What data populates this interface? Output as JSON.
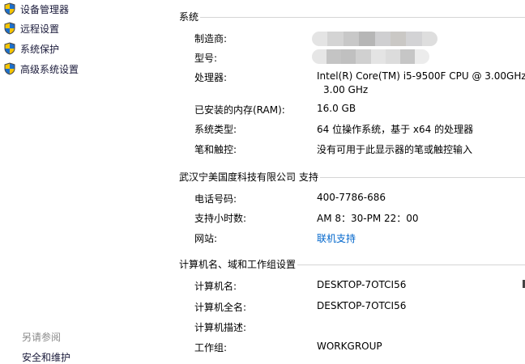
{
  "sidebar": {
    "items": [
      {
        "label": "设备管理器",
        "icon": "uac-shield-icon"
      },
      {
        "label": "远程设置",
        "icon": "uac-shield-icon"
      },
      {
        "label": "系统保护",
        "icon": "uac-shield-icon"
      },
      {
        "label": "高级系统设置",
        "icon": "uac-shield-icon"
      }
    ],
    "see_also": "另请参阅",
    "see_also_link": "安全和维护"
  },
  "system": {
    "title": "系统",
    "manufacturer_label": "制造商:",
    "model_label": "型号:",
    "processor_label": "处理器:",
    "processor_value": "Intel(R) Core(TM) i5-9500F CPU @ 3.00GHz",
    "processor_value2": "3.00 GHz",
    "ram_label": "已安装的内存(RAM):",
    "ram_value": "16.0 GB",
    "type_label": "系统类型:",
    "type_value": "64 位操作系统，基于 x64 的处理器",
    "pen_label": "笔和触控:",
    "pen_value": "没有可用于此显示器的笔或触控输入"
  },
  "support": {
    "title": "武汉宁美国度科技有限公司 支持",
    "phone_label": "电话号码:",
    "phone_value": "400-7786-686",
    "hours_label": "支持小时数:",
    "hours_value": "AM 8：30-PM 22：00",
    "site_label": "网站:",
    "site_value": "联机支持"
  },
  "computer": {
    "title": "计算机名、域和工作组设置",
    "name_label": "计算机名:",
    "name_value": "DESKTOP-7OTCI56",
    "fullname_label": "计算机全名:",
    "fullname_value": "DESKTOP-7OTCI56",
    "desc_label": "计算机描述:",
    "workgroup_label": "工作组:",
    "workgroup_value": "WORKGROUP"
  },
  "colors": {
    "link": "#0066cc",
    "shield_blue": "#1e6fc8",
    "shield_yellow": "#f5c400"
  }
}
